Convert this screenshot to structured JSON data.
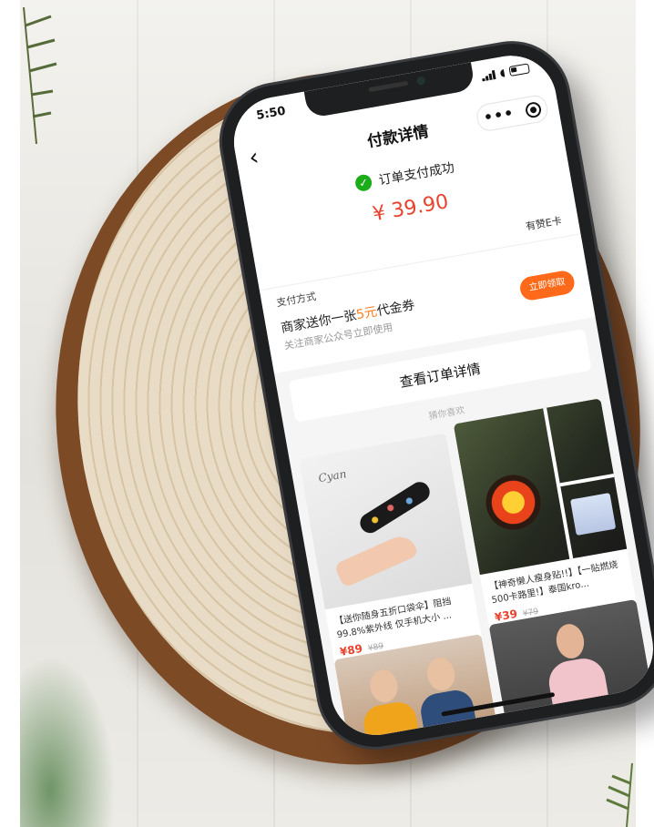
{
  "statusbar": {
    "time": "5:50"
  },
  "navbar": {
    "back_glyph": "‹",
    "title": "付款详情",
    "more_glyph": "•••"
  },
  "payment": {
    "check_glyph": "✓",
    "status_text": "订单支付成功",
    "amount": "¥ 39.90",
    "merchant": "有赞E卡"
  },
  "coupon": {
    "section_label": "支付方式",
    "title_before": "商家送你一张",
    "title_highlight": "5元",
    "title_after": "代金券",
    "subtitle": "关注商家公众号立即使用",
    "claim_label": "立即领取"
  },
  "order_details_label": "查看订单详情",
  "guess_label": "猜你喜欢",
  "products": [
    {
      "title": "【送你随身五折口袋伞】阻挡99.8%紫外线 仅手机大小 ...",
      "price": "¥89",
      "original_price": "¥89"
    },
    {
      "title": "【神奇懒人瘦身贴!!】【一贴燃烧500卡路里!】泰国kro...",
      "price": "¥39",
      "original_price": "¥79"
    },
    {
      "title": "",
      "price": "",
      "original_price": ""
    },
    {
      "title": "",
      "price": "",
      "original_price": ""
    }
  ],
  "colors": {
    "accent_red": "#e8432e",
    "accent_orange": "#ff6a1a",
    "success_green": "#1aad19"
  },
  "icons": [
    "back-arrow-icon",
    "more-dots-icon",
    "target-icon",
    "check-icon",
    "signal-icon",
    "wifi-icon",
    "battery-icon"
  ]
}
